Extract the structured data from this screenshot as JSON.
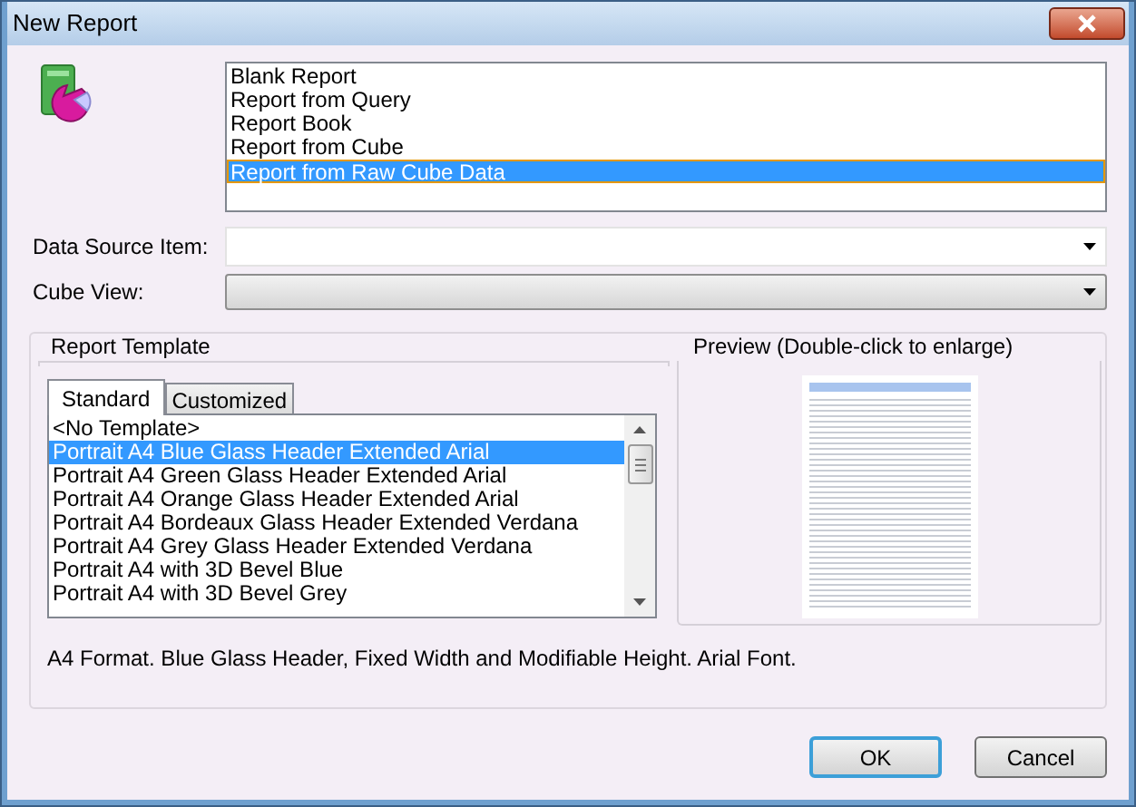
{
  "window": {
    "title": "New Report"
  },
  "report_types": [
    {
      "label": "Blank Report",
      "selected": false
    },
    {
      "label": "Report from Query",
      "selected": false
    },
    {
      "label": "Report Book",
      "selected": false
    },
    {
      "label": "Report from Cube",
      "selected": false
    },
    {
      "label": "Report from Raw Cube Data",
      "selected": true
    }
  ],
  "fields": [
    {
      "label": "Data Source Item:",
      "disabled": false
    },
    {
      "label": "Cube View:",
      "disabled": true
    }
  ],
  "report_template": {
    "title": "Report Template",
    "tabs": [
      {
        "label": "Standard",
        "selected": true
      },
      {
        "label": "Customized",
        "selected": false
      }
    ],
    "templates": [
      {
        "label": "<No Template>",
        "selected": false
      },
      {
        "label": "Portrait A4 Blue Glass Header Extended Arial",
        "selected": true
      },
      {
        "label": "Portrait A4 Green Glass Header Extended Arial",
        "selected": false
      },
      {
        "label": "Portrait A4 Orange Glass Header Extended Arial",
        "selected": false
      },
      {
        "label": "Portrait A4 Bordeaux Glass Header Extended Verdana",
        "selected": false
      },
      {
        "label": "Portrait A4 Grey Glass Header Extended Verdana",
        "selected": false
      },
      {
        "label": "Portrait A4 with 3D Bevel Blue",
        "selected": false
      },
      {
        "label": "Portrait A4 with 3D Bevel Grey",
        "selected": false
      }
    ]
  },
  "preview": {
    "title": "Preview (Double-click to enlarge)"
  },
  "description": "A4 Format. Blue Glass Header, Fixed Width and Modifiable Height. Arial Font.",
  "buttons": [
    {
      "label": "OK",
      "default": true
    },
    {
      "label": "Cancel",
      "default": false
    }
  ]
}
